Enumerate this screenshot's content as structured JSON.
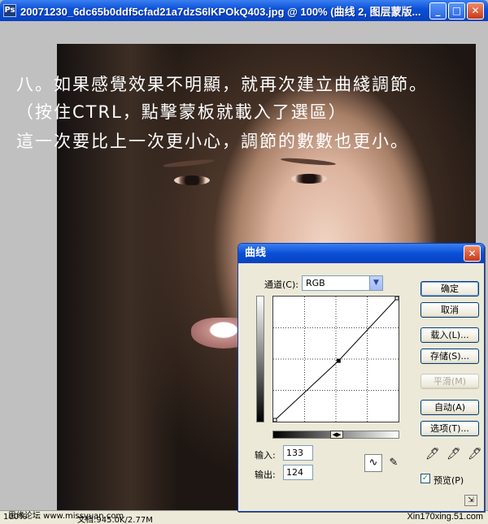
{
  "window": {
    "icon": "photoshop-icon",
    "title": "20071230_6dc65b0ddf5cfad21a7dzS6lKPOkQ403.jpg @ 100% (曲线 2, 图层蒙版..."
  },
  "overlay": {
    "line1": "八。如果感覺效果不明顯，就再次建立曲綫調節。",
    "line2": "（按住CTRL，點擊蒙板就載入了選區）",
    "line3": "這一次要比上一次更小心，調節的數數也更小。"
  },
  "status": {
    "zoom": "100%",
    "doc": "文档:945.0K/2.77M"
  },
  "watermarks": {
    "left": "思缘论坛  www.missyuan.com",
    "right": "Xin170xing.51.com"
  },
  "dialog": {
    "title": "曲线",
    "channel_label": "通道(C):",
    "channel_value": "RGB",
    "input_label": "输入:",
    "input_value": "133",
    "output_label": "输出:",
    "output_value": "124",
    "buttons": {
      "ok": "确定",
      "cancel": "取消",
      "load": "载入(L)...",
      "save": "存储(S)...",
      "smooth": "平滑(M)",
      "auto": "自动(A)",
      "options": "选项(T)..."
    },
    "preview_label": "预览(P)",
    "preview_checked": true,
    "curve_point": {
      "input": 133,
      "output": 124
    }
  }
}
